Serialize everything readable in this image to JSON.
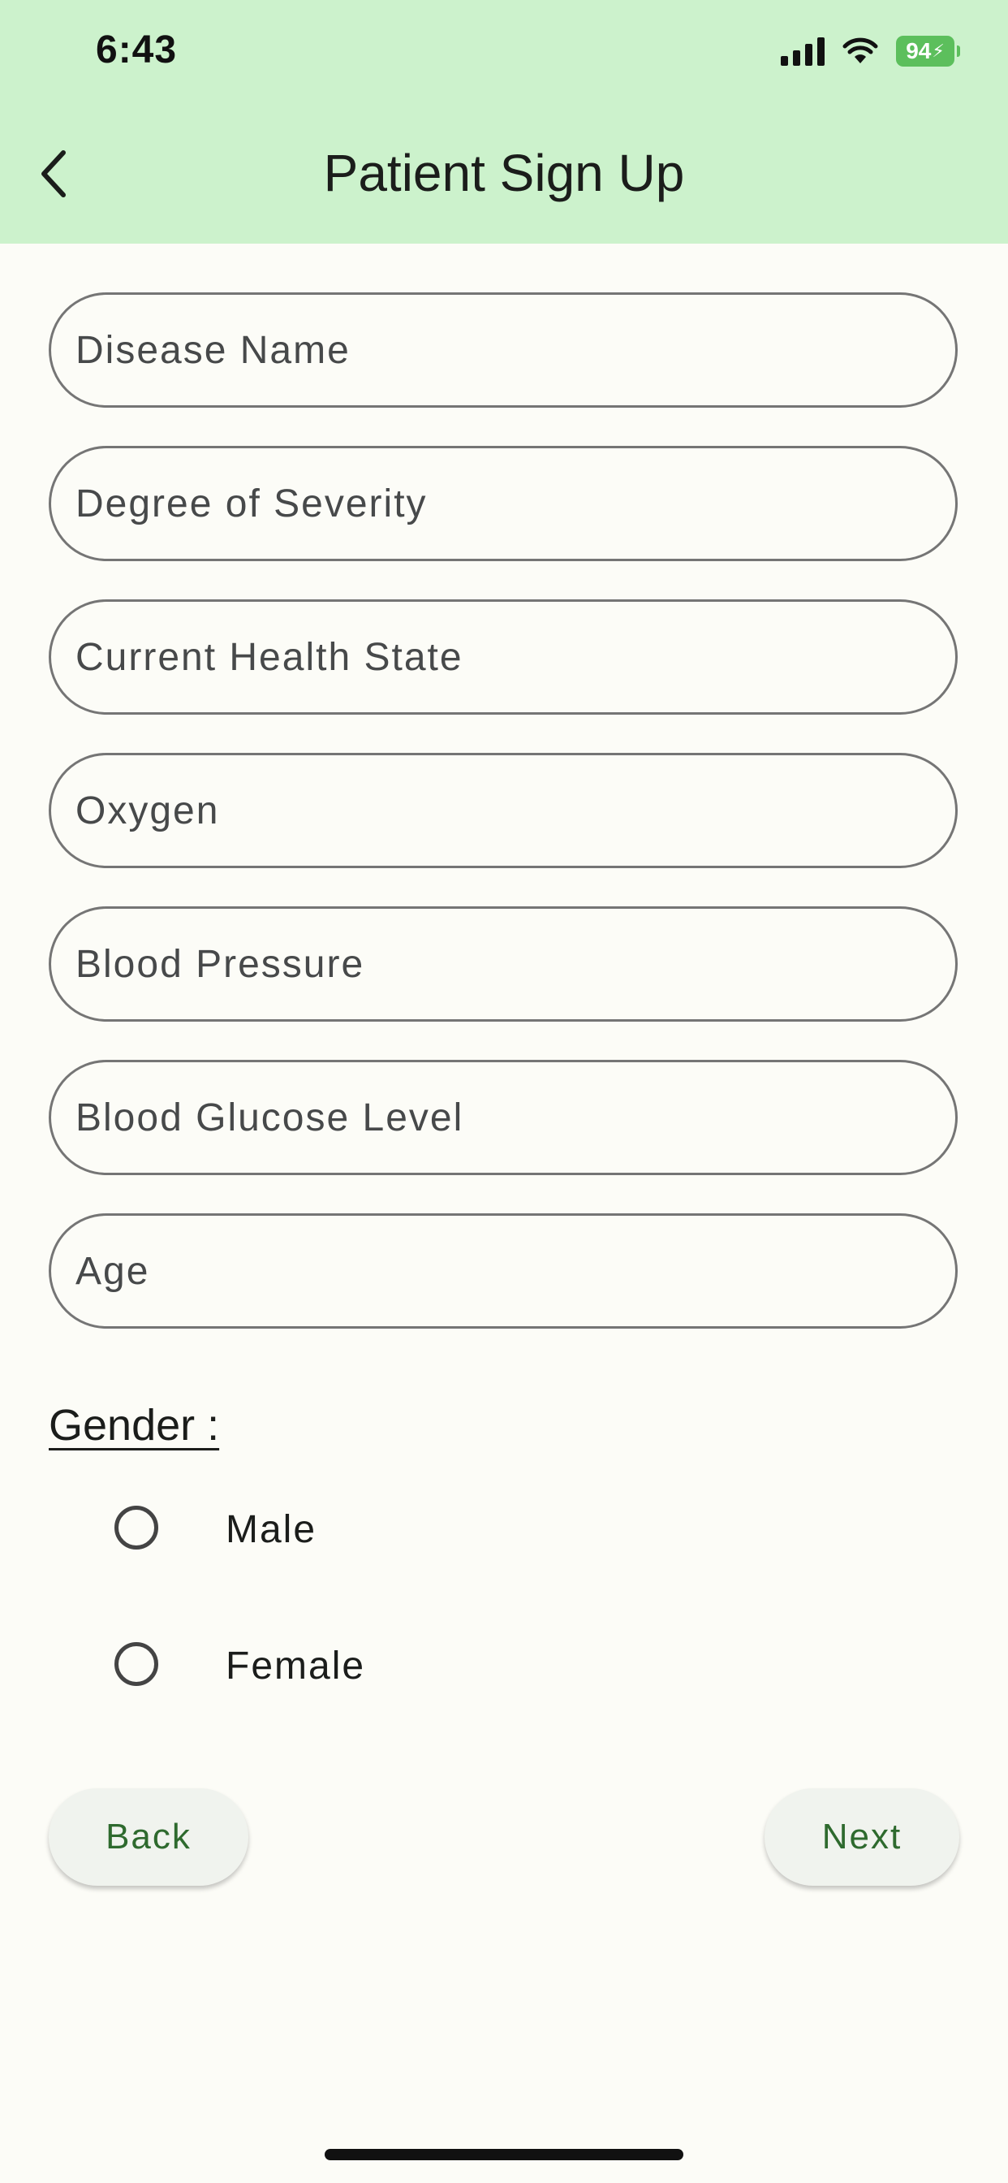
{
  "status_bar": {
    "time": "6:43",
    "battery": "94",
    "icons": [
      "cellular-signal-icon",
      "wifi-icon",
      "battery-charging-icon"
    ]
  },
  "header": {
    "title": "Patient Sign Up",
    "back_icon": "chevron-left-icon",
    "background_color": "#ccf2cc"
  },
  "form": {
    "fields": [
      {
        "name": "disease-name-input",
        "placeholder": "Disease Name",
        "value": ""
      },
      {
        "name": "degree-of-severity-input",
        "placeholder": "Degree of Severity",
        "value": ""
      },
      {
        "name": "current-health-state-input",
        "placeholder": "Current Health State",
        "value": ""
      },
      {
        "name": "oxygen-input",
        "placeholder": "Oxygen",
        "value": ""
      },
      {
        "name": "blood-pressure-input",
        "placeholder": "Blood Pressure",
        "value": ""
      },
      {
        "name": "blood-glucose-level-input",
        "placeholder": "Blood Glucose Level",
        "value": ""
      },
      {
        "name": "age-input",
        "placeholder": "Age",
        "value": ""
      }
    ],
    "gender": {
      "label": "Gender :",
      "options": [
        {
          "label": "Male",
          "selected": false
        },
        {
          "label": "Female",
          "selected": false
        }
      ]
    }
  },
  "actions": {
    "back_label": "Back",
    "next_label": "Next",
    "accent_color": "#2e6a2e"
  }
}
